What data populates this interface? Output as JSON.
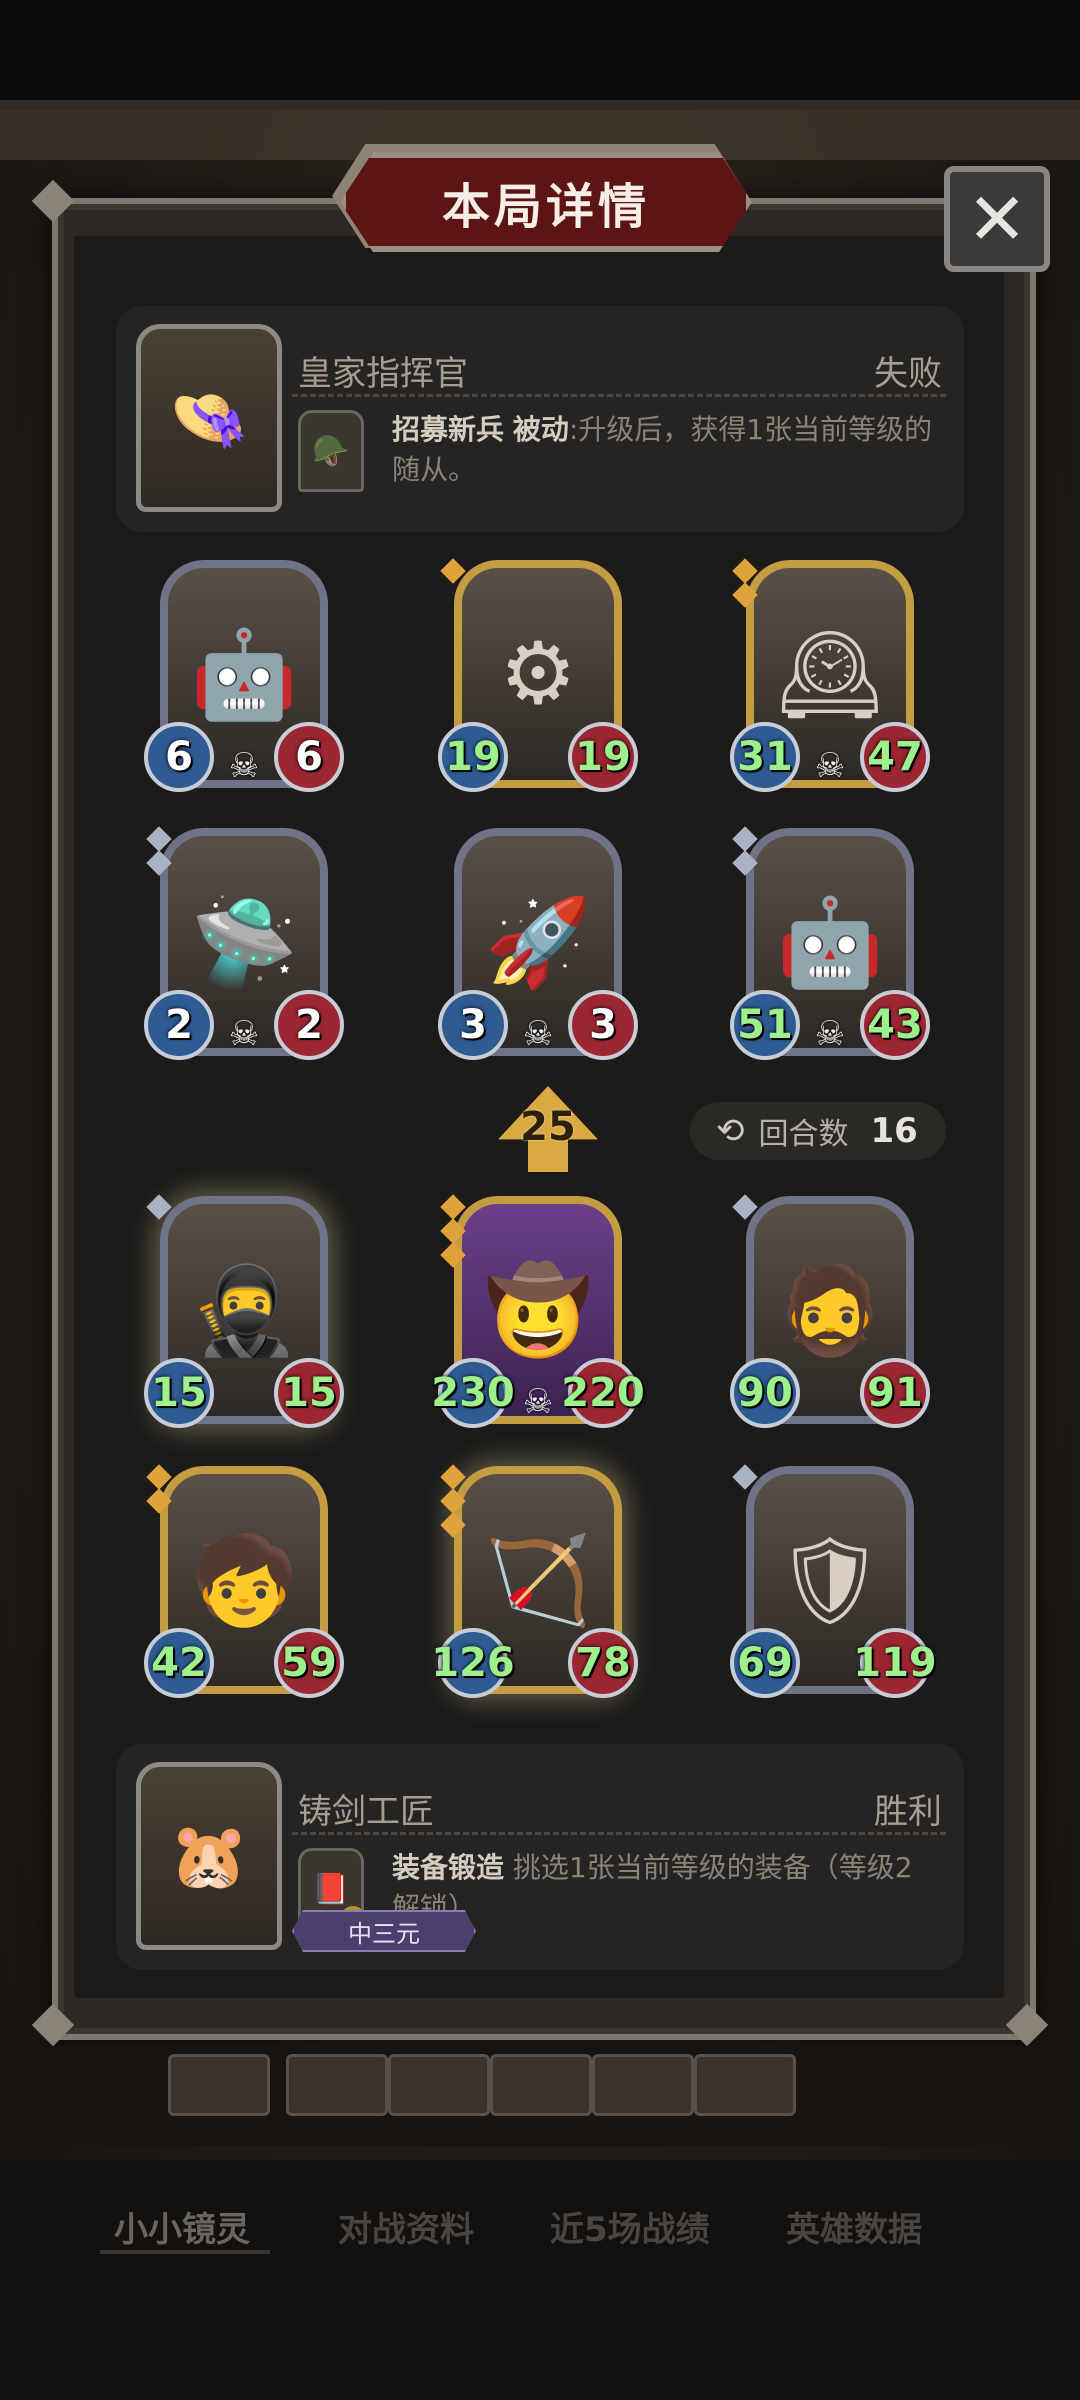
{
  "dialog": {
    "title": "本局详情",
    "close_label": "✕"
  },
  "top_player": {
    "portrait_icon": "commander-portrait",
    "name": "皇家指挥官",
    "result": "失败",
    "skill_icon": "recruit-skill-icon",
    "skill_name": "招募新兵",
    "skill_type": "被动",
    "skill_desc": ":升级后，获得1张当前等级的随从。"
  },
  "bottom_player": {
    "portrait_icon": "swordsmith-portrait",
    "name": "铸剑工匠",
    "result": "胜利",
    "skill_icon": "forge-skill-icon",
    "skill_badge": "2",
    "skill_name": "装备锻造",
    "skill_desc": " 挑选1张当前等级的装备（等级2解锁）",
    "tag": "中三元"
  },
  "opponent_board": [
    {
      "atk": "6",
      "hp": "6",
      "frame": "silver",
      "stars": 0,
      "skull": true,
      "green": false,
      "glyph": "🤖"
    },
    {
      "atk": "19",
      "hp": "19",
      "frame": "gold",
      "stars": 1,
      "skull": false,
      "green": true,
      "glyph": "⚙"
    },
    {
      "atk": "31",
      "hp": "47",
      "frame": "gold",
      "stars": 2,
      "skull": true,
      "green": true,
      "glyph": "🕰"
    },
    {
      "atk": "2",
      "hp": "2",
      "frame": "silver",
      "stars": 2,
      "skull": true,
      "green": false,
      "glyph": "🛸"
    },
    {
      "atk": "3",
      "hp": "3",
      "frame": "silver",
      "stars": 0,
      "skull": true,
      "green": false,
      "glyph": "🚀"
    },
    {
      "atk": "51",
      "hp": "43",
      "frame": "silver",
      "stars": 2,
      "skull": true,
      "green": true,
      "glyph": "🤖"
    }
  ],
  "tier": "25",
  "round": {
    "label": "回合数",
    "value": "16",
    "icon": "refresh-icon"
  },
  "player_board": [
    {
      "atk": "15",
      "hp": "15",
      "frame": "silver",
      "stars": 1,
      "skull": false,
      "green": true,
      "glow": true,
      "glyph": "🥷"
    },
    {
      "atk": "230",
      "hp": "220",
      "frame": "gold",
      "stars": 3,
      "skull": true,
      "green": true,
      "purple": true,
      "glyph": "🤠"
    },
    {
      "atk": "90",
      "hp": "91",
      "frame": "silver",
      "stars": 1,
      "skull": false,
      "green": true,
      "glyph": "🧔"
    },
    {
      "atk": "42",
      "hp": "59",
      "frame": "gold",
      "stars": 2,
      "skull": false,
      "green": true,
      "glyph": "🧒"
    },
    {
      "atk": "126",
      "hp": "78",
      "frame": "gold",
      "stars": 3,
      "skull": false,
      "green": true,
      "glow": true,
      "glyph": "🏹"
    },
    {
      "atk": "69",
      "hp": "119",
      "frame": "silver",
      "stars": 1,
      "skull": false,
      "green": true,
      "glyph": "🛡"
    }
  ],
  "bottom_nav": {
    "tabs": [
      "小小镜灵",
      "对战资料",
      "近5场战绩",
      "英雄数据"
    ]
  }
}
